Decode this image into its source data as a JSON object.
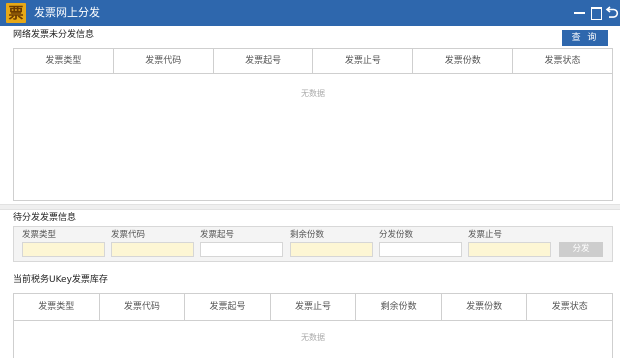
{
  "window": {
    "app_icon_glyph": "票",
    "title": "发票网上分发",
    "controls": [
      "minimize-icon",
      "maximize-icon",
      "back-icon"
    ]
  },
  "section1": {
    "title": "网络发票未分发信息",
    "query_label": "查 询",
    "columns": [
      "发票类型",
      "发票代码",
      "发票起号",
      "发票止号",
      "发票份数",
      "发票状态"
    ],
    "empty_text": "无数据"
  },
  "section2": {
    "title": "待分发发票信息",
    "fields": [
      {
        "label": "发票类型",
        "value": ""
      },
      {
        "label": "发票代码",
        "value": ""
      },
      {
        "label": "发票起号",
        "value": ""
      },
      {
        "label": "剩余份数",
        "value": ""
      },
      {
        "label": "分发份数",
        "value": ""
      },
      {
        "label": "发票止号",
        "value": ""
      }
    ],
    "distribute_label": "分发"
  },
  "section3": {
    "title": "当前税务UKey发票库存",
    "columns": [
      "发票类型",
      "发票代码",
      "发票起号",
      "发票止号",
      "剩余份数",
      "发票份数",
      "发票状态"
    ],
    "empty_text": "无数据"
  },
  "colors": {
    "titlebar": "#2e67ad",
    "app_icon": "#e6a817",
    "input_highlight": "#fdf6d4",
    "disabled_button": "#cdcdcd"
  }
}
